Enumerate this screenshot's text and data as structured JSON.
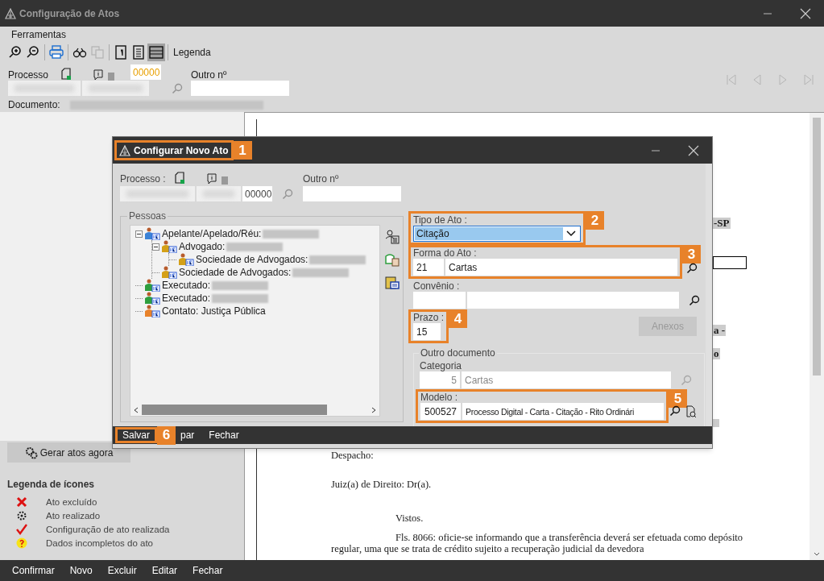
{
  "window": {
    "title": "Configuração de Atos"
  },
  "menu": [
    {
      "label": "Ferramentas"
    }
  ],
  "toolbar": {
    "groups": [
      [
        {
          "kind": "zoom-in",
          "selected": false,
          "disabled": false
        },
        {
          "kind": "zoom-out",
          "selected": false,
          "disabled": false
        }
      ],
      [
        {
          "kind": "print",
          "selected": false,
          "disabled": false
        }
      ],
      [
        {
          "kind": "binoculars",
          "selected": false,
          "disabled": false
        },
        {
          "kind": "copy",
          "selected": false,
          "disabled": true
        }
      ],
      [
        {
          "kind": "page",
          "selected": false,
          "disabled": false
        },
        {
          "kind": "list",
          "selected": false,
          "disabled": false
        },
        {
          "kind": "layout",
          "selected": true,
          "disabled": false
        }
      ]
    ],
    "legend_label": "Legenda"
  },
  "process": {
    "label": "Processo",
    "number": "00000",
    "other_label": "Outro nº"
  },
  "document": {
    "label": "Documento:"
  },
  "generate_button": {
    "label": "Gerar atos agora"
  },
  "legend": {
    "title": "Legenda de ícones",
    "items": [
      {
        "kind": "deleted",
        "label": "Ato excluído"
      },
      {
        "kind": "done",
        "label": "Ato realizado"
      },
      {
        "kind": "configured",
        "label": "Configuração de ato realizada"
      },
      {
        "kind": "incomplete",
        "label": "Dados incompletos do ato"
      }
    ]
  },
  "document_page": {
    "fragments": [
      {
        "kind": "text",
        "text": "-SP"
      },
      {
        "kind": "box"
      },
      {
        "kind": "text",
        "text": "a -"
      },
      {
        "kind": "text",
        "text": "o"
      },
      {
        "kind": "blank"
      }
    ],
    "paragraphs": [
      {
        "kind": "heading",
        "text": "Despacho:"
      },
      {
        "kind": "heading",
        "text": "Juiz(a) de Direito: Dr(a)."
      },
      {
        "kind": "indent",
        "text": "Vistos."
      },
      {
        "kind": "indent",
        "text": "Fls. 8066: oficie-se informando que a transferência deverá ser efetuada como depósito"
      },
      {
        "kind": "body",
        "text": "regular, uma que se trata de crédito sujeito a recuperação judicial da devedora"
      }
    ]
  },
  "bottom_bar": [
    {
      "label": "Confirmar"
    },
    {
      "label": "Novo"
    },
    {
      "label": "Excluir"
    },
    {
      "label": "Editar"
    },
    {
      "label": "Fechar"
    }
  ],
  "dialog": {
    "title": "Configurar Novo Ato",
    "title_callout": "1",
    "process_label": "Processo :",
    "process_number": "00000",
    "other_label": "Outro nº",
    "people": {
      "title": "Pessoas",
      "tree": [
        {
          "label": "Apelante/Apelado/Réu:",
          "color": "#3b82d6",
          "expanded": true,
          "children": [
            {
              "label": "Advogado:",
              "color": "#d4a017",
              "expanded": true,
              "children": [
                {
                  "label": "Sociedade de Advogados:",
                  "color": "#d4a017"
                }
              ]
            },
            {
              "label": "Sociedade de Advogados:",
              "color": "#d4a017"
            }
          ]
        },
        {
          "label": "Executado:",
          "color": "#2e9e3e"
        },
        {
          "label": "Executado:",
          "color": "#2e9e3e"
        },
        {
          "label": "Contato: Justiça Pública",
          "color": "#e8822a",
          "plain": true
        }
      ]
    },
    "tipo": {
      "label": "Tipo de Ato :",
      "value": "Citação",
      "callout": "2"
    },
    "forma": {
      "label": "Forma do Ato :",
      "code": "21",
      "name": "Cartas",
      "callout": "3"
    },
    "convenio": {
      "label": "Convênio :"
    },
    "prazo": {
      "label": "Prazo :",
      "value": "15",
      "callout": "4"
    },
    "anexos": {
      "label": "Anexos",
      "disabled": true
    },
    "outro_documento": {
      "title": "Outro documento",
      "categoria_label": "Categoria",
      "categoria_code": "5",
      "categoria_name": "Cartas",
      "modelo_label": "Modelo :",
      "modelo_code": "500527",
      "modelo_name": "Processo Digital - Carta - Citação - Rito Ordinári",
      "modelo_callout": "5"
    },
    "footer": [
      {
        "label": "Salvar",
        "callout": "6"
      },
      {
        "label": "par"
      },
      {
        "label": "Fechar"
      }
    ]
  }
}
